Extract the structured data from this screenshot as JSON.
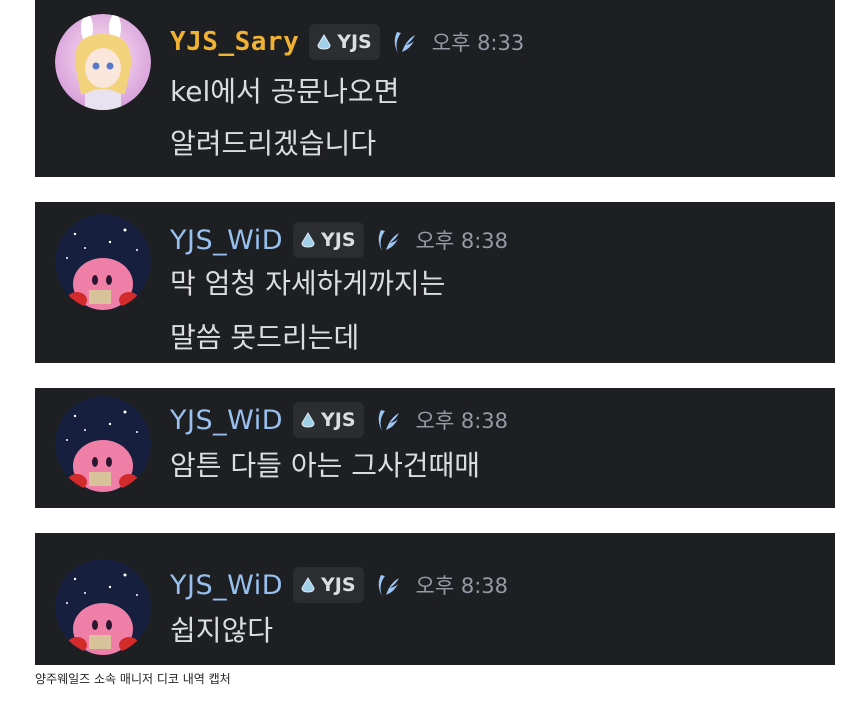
{
  "messages": [
    {
      "username": "YJS_Sary",
      "tag": "YJS",
      "time": "오후 8:33",
      "lines": [
        "kel에서 공문나오면",
        "알려드리겠습니다"
      ]
    },
    {
      "username": "YJS_WiD",
      "tag": "YJS",
      "time": "오후 8:38",
      "lines": [
        "막 엄청 자세하게까지는",
        "말씀 못드리는데"
      ]
    },
    {
      "username": "YJS_WiD",
      "tag": "YJS",
      "time": "오후 8:38",
      "lines": [
        "암튼 다들 아는 그사건때매"
      ]
    },
    {
      "username": "YJS_WiD",
      "tag": "YJS",
      "time": "오후 8:38",
      "lines": [
        "쉽지않다"
      ]
    }
  ],
  "caption": "양주웨일즈 소속 매니저 디코 내역 캡처",
  "colors": {
    "background": "#1e1f22",
    "sary_name": "#f0b232",
    "wid_name": "#98c0ee",
    "message_text": "#dbdee1",
    "timestamp": "#949ba4"
  },
  "icons": [
    "water-drop-icon",
    "wheat-role-icon"
  ]
}
